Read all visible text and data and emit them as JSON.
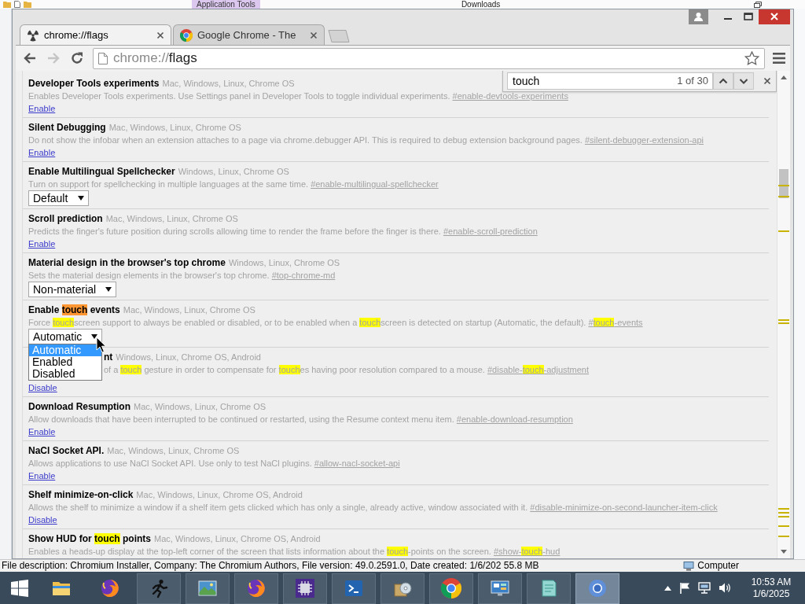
{
  "background_window": {
    "ribbon_tab": "Application Tools",
    "title": "Downloads",
    "status": "File description: Chromium Installer, Company: The Chromium Authors, File version: 49.0.2591.0, Date created: 1/6/202 55.8 MB",
    "location": "Computer"
  },
  "tabs": [
    {
      "kind": "experiments",
      "title": "chrome://flags",
      "selected": true
    },
    {
      "kind": "browser",
      "title": "Google Chrome - The",
      "selected": false
    }
  ],
  "toolbar": {
    "buttons": [
      {
        "kind": "back",
        "disabled": false
      },
      {
        "kind": "forward",
        "disabled": true
      },
      {
        "kind": "reload",
        "disabled": false
      }
    ],
    "address": {
      "scheme": "chrome://",
      "path": "flags"
    }
  },
  "find_bar": {
    "query": "touch",
    "count": "1 of 30"
  },
  "flags": [
    {
      "title": "Developer Tools experiments",
      "platforms": "Mac, Windows, Linux, Chrome OS",
      "description": "Enables Developer Tools experiments. Use Settings panel in Developer Tools to toggle individual experiments.",
      "anchor": "#enable-devtools-experiments",
      "control": {
        "kind": "link",
        "label": "Enable"
      }
    },
    {
      "title": "Silent Debugging",
      "platforms": "Mac, Windows, Linux, Chrome OS",
      "description": "Do not show the infobar when an extension attaches to a page via chrome.debugger API. This is required to debug extension background pages.",
      "anchor": "#silent-debugger-extension-api",
      "control": {
        "kind": "link",
        "label": "Enable"
      }
    },
    {
      "title": "Enable Multilingual Spellchecker",
      "platforms": "Windows, Linux, Chrome OS",
      "description": "Turn on support for spellchecking in multiple languages at the same time.",
      "anchor": "#enable-multilingual-spellchecker",
      "control": {
        "kind": "select",
        "value": "Default",
        "expanded": false
      }
    },
    {
      "title": "Scroll prediction",
      "platforms": "Mac, Windows, Linux, Chrome OS",
      "description": "Predicts the finger's future position during scrolls allowing time to render the frame before the finger is there.",
      "anchor": "#enable-scroll-prediction",
      "control": {
        "kind": "link",
        "label": "Enable"
      }
    },
    {
      "title": "Material design in the browser's top chrome",
      "platforms": "Windows, Linux, Chrome OS",
      "description": "Sets the material design elements in the browser's top chrome.",
      "anchor": "#top-chrome-md",
      "control": {
        "kind": "select",
        "value": "Non-material",
        "expanded": false
      }
    },
    {
      "title": [
        {
          "kind": "plain",
          "text": "Enable "
        },
        {
          "kind": "match",
          "text": "touch",
          "selected": true
        },
        {
          "kind": "plain",
          "text": " events"
        }
      ],
      "platforms": "Mac, Windows, Linux, Chrome OS",
      "description": [
        {
          "kind": "plain",
          "text": "Force "
        },
        {
          "kind": "match",
          "text": "touch",
          "selected": false
        },
        {
          "kind": "plain",
          "text": "screen support to always be enabled or disabled, or to be enabled when a "
        },
        {
          "kind": "match",
          "text": "touch",
          "selected": false
        },
        {
          "kind": "plain",
          "text": "screen is detected on startup (Automatic, the default)."
        }
      ],
      "anchor": [
        {
          "kind": "plain",
          "text": "#"
        },
        {
          "kind": "match",
          "text": "touch",
          "selected": false
        },
        {
          "kind": "plain",
          "text": "-events"
        }
      ],
      "control": {
        "kind": "select",
        "value": "Automatic",
        "expanded": true,
        "options": [
          {
            "label": "Automatic",
            "selected": true
          },
          {
            "label": "Enabled",
            "selected": false
          },
          {
            "label": "Disabled",
            "selected": false
          }
        ]
      }
    },
    {
      "title": "nt",
      "platforms": "Windows, Linux, Chrome OS, Android",
      "description": [
        {
          "kind": "plain",
          "text": "of a "
        },
        {
          "kind": "match",
          "text": "touch",
          "selected": false
        },
        {
          "kind": "plain",
          "text": " gesture in order to compensate for "
        },
        {
          "kind": "match",
          "text": "touch",
          "selected": false
        },
        {
          "kind": "plain",
          "text": "es having poor resolution compared to a mouse."
        }
      ],
      "anchor": [
        {
          "kind": "plain",
          "text": "#disable-"
        },
        {
          "kind": "match",
          "text": "touch",
          "selected": false
        },
        {
          "kind": "plain",
          "text": "-adjustment"
        }
      ],
      "control": {
        "kind": "link",
        "label": "Disable"
      }
    },
    {
      "title": "Download Resumption",
      "platforms": "Mac, Windows, Linux, Chrome OS",
      "description": "Allow downloads that have been interrupted to be continued or restarted, using the Resume context menu item.",
      "anchor": "#enable-download-resumption",
      "control": {
        "kind": "link",
        "label": "Enable"
      }
    },
    {
      "title": "NaCl Socket API.",
      "platforms": "Mac, Windows, Linux, Chrome OS",
      "description": "Allows applications to use NaCl Socket API. Use only to test NaCl plugins.",
      "anchor": "#allow-nacl-socket-api",
      "control": {
        "kind": "link",
        "label": "Enable"
      }
    },
    {
      "title": "Shelf minimize-on-click",
      "platforms": "Mac, Windows, Linux, Chrome OS, Android",
      "description": "Allows the shelf to minimize a window if a shelf item gets clicked which has only a single, already active, window associated with it.",
      "anchor": "#disable-minimize-on-second-launcher-item-click",
      "control": {
        "kind": "link",
        "label": "Disable"
      }
    },
    {
      "title": [
        {
          "kind": "plain",
          "text": "Show HUD for "
        },
        {
          "kind": "match",
          "text": "touch",
          "selected": false
        },
        {
          "kind": "plain",
          "text": " points"
        }
      ],
      "platforms": "Mac, Windows, Linux, Chrome OS, Android",
      "description": [
        {
          "kind": "plain",
          "text": "Enables a heads-up display at the top-left corner of the screen that lists information about the "
        },
        {
          "kind": "match",
          "text": "touch",
          "selected": false
        },
        {
          "kind": "plain",
          "text": "-points on the screen."
        }
      ],
      "anchor": [
        {
          "kind": "plain",
          "text": "#show-"
        },
        {
          "kind": "match",
          "text": "touch",
          "selected": false
        },
        {
          "kind": "plain",
          "text": "-hud"
        }
      ]
    }
  ],
  "taskbar": {
    "items": [
      {
        "kind": "folder",
        "running": false,
        "selected": false
      },
      {
        "kind": "foxglobe",
        "running": false,
        "selected": false
      },
      {
        "kind": "runner",
        "running": true,
        "selected": false
      },
      {
        "kind": "picture",
        "running": true,
        "selected": false
      },
      {
        "kind": "foxglobe",
        "running": true,
        "selected": false
      },
      {
        "kind": "chip",
        "running": true,
        "selected": false
      },
      {
        "kind": "terminal",
        "running": true,
        "selected": false
      },
      {
        "kind": "package",
        "running": true,
        "selected": false
      },
      {
        "kind": "tricolor",
        "running": true,
        "selected": false
      },
      {
        "kind": "monitor",
        "running": true,
        "selected": false
      },
      {
        "kind": "notebook",
        "running": true,
        "selected": false
      },
      {
        "kind": "ring",
        "running": true,
        "selected": true
      }
    ],
    "clock": {
      "time": "10:53 AM",
      "date": "1/6/2025"
    }
  }
}
